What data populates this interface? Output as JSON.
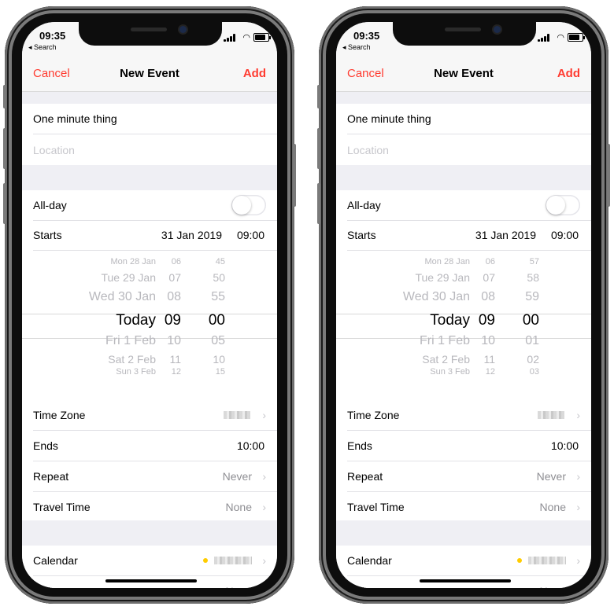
{
  "screens": [
    {
      "status": {
        "time": "09:35",
        "back_label": "◂ Search"
      },
      "nav": {
        "cancel": "Cancel",
        "title": "New Event",
        "add": "Add"
      },
      "event": {
        "title": "One minute thing",
        "location_placeholder": "Location"
      },
      "allday": {
        "label": "All-day",
        "on": false
      },
      "starts": {
        "label": "Starts",
        "date": "31 Jan 2019",
        "time": "09:00"
      },
      "picker": {
        "dates": [
          "Mon 28 Jan",
          "Tue 29 Jan",
          "Wed 30 Jan",
          "Today",
          "Fri 1 Feb",
          "Sat 2 Feb",
          "Sun 3 Feb"
        ],
        "hours": [
          "06",
          "07",
          "08",
          "09",
          "10",
          "11",
          "12"
        ],
        "minutes": [
          "45",
          "50",
          "55",
          "00",
          "05",
          "10",
          "15"
        ]
      },
      "timezone": {
        "label": "Time Zone"
      },
      "ends": {
        "label": "Ends",
        "time": "10:00"
      },
      "repeat": {
        "label": "Repeat",
        "value": "Never"
      },
      "travel": {
        "label": "Travel Time",
        "value": "None"
      },
      "calendar": {
        "label": "Calendar"
      },
      "invitees": {
        "label": "Invitees",
        "value": "None"
      }
    },
    {
      "status": {
        "time": "09:35",
        "back_label": "◂ Search"
      },
      "nav": {
        "cancel": "Cancel",
        "title": "New Event",
        "add": "Add"
      },
      "event": {
        "title": "One minute thing",
        "location_placeholder": "Location"
      },
      "allday": {
        "label": "All-day",
        "on": false
      },
      "starts": {
        "label": "Starts",
        "date": "31 Jan 2019",
        "time": "09:00"
      },
      "picker": {
        "dates": [
          "Mon 28 Jan",
          "Tue 29 Jan",
          "Wed 30 Jan",
          "Today",
          "Fri 1 Feb",
          "Sat 2 Feb",
          "Sun 3 Feb"
        ],
        "hours": [
          "06",
          "07",
          "08",
          "09",
          "10",
          "11",
          "12"
        ],
        "minutes": [
          "57",
          "58",
          "59",
          "00",
          "01",
          "02",
          "03"
        ]
      },
      "timezone": {
        "label": "Time Zone"
      },
      "ends": {
        "label": "Ends",
        "time": "10:00"
      },
      "repeat": {
        "label": "Repeat",
        "value": "Never"
      },
      "travel": {
        "label": "Travel Time",
        "value": "None"
      },
      "calendar": {
        "label": "Calendar"
      },
      "invitees": {
        "label": "Invitees",
        "value": "None"
      }
    }
  ],
  "colors": {
    "accent": "#ff3b30",
    "calendar_dot": "#ffcc00"
  }
}
